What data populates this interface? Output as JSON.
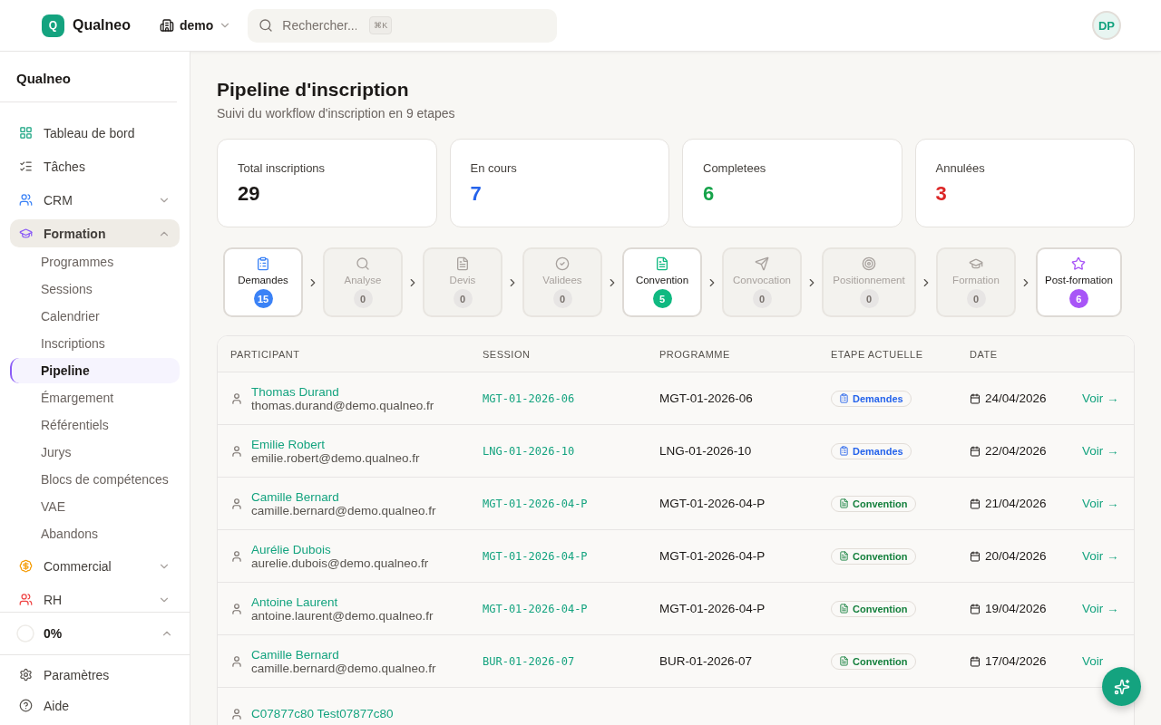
{
  "header": {
    "logo_letter": "Q",
    "brand": "Qualneo",
    "workspace": "demo",
    "search": {
      "placeholder": "Rechercher...",
      "shortcut": "⌘K"
    },
    "avatar": "DP"
  },
  "sidebar": {
    "title": "Qualneo",
    "items": [
      {
        "label": "Tableau de bord",
        "selected": false
      },
      {
        "label": "Tâches",
        "selected": false
      },
      {
        "label": "CRM",
        "selected": false,
        "expanded": false
      },
      {
        "label": "Formation",
        "selected": true,
        "expanded": true,
        "children": [
          {
            "label": "Programmes",
            "selected": false
          },
          {
            "label": "Sessions",
            "selected": false
          },
          {
            "label": "Calendrier",
            "selected": false
          },
          {
            "label": "Inscriptions",
            "selected": false
          },
          {
            "label": "Pipeline",
            "selected": true
          },
          {
            "label": "Émargement",
            "selected": false
          },
          {
            "label": "Référentiels",
            "selected": false
          },
          {
            "label": "Jurys",
            "selected": false
          },
          {
            "label": "Blocs de compétences",
            "selected": false
          },
          {
            "label": "VAE",
            "selected": false
          },
          {
            "label": "Abandons",
            "selected": false
          }
        ]
      },
      {
        "label": "Commercial",
        "selected": false,
        "expanded": false
      },
      {
        "label": "RH",
        "selected": false,
        "expanded": false
      }
    ],
    "progress": {
      "reading": "0%"
    },
    "footer": [
      {
        "label": "Paramètres"
      },
      {
        "label": "Aide"
      }
    ]
  },
  "page": {
    "title": "Pipeline d'inscription",
    "subtitle": "Suivi du workflow d'inscription en 9 etapes"
  },
  "stats": [
    {
      "label": "Total inscriptions",
      "value": "29",
      "color": "#1c1917"
    },
    {
      "label": "En cours",
      "value": "7",
      "color": "#2563eb"
    },
    {
      "label": "Completees",
      "value": "6",
      "color": "#16a34a"
    },
    {
      "label": "Annulées",
      "value": "3",
      "color": "#dc2626"
    }
  ],
  "stages": [
    {
      "label": "Demandes",
      "count": "15",
      "active": true,
      "color": "#3b82f6"
    },
    {
      "label": "Analyse",
      "count": "0",
      "active": false,
      "color": "#e7e5e4"
    },
    {
      "label": "Devis",
      "count": "0",
      "active": false,
      "color": "#e7e5e4"
    },
    {
      "label": "Validees",
      "count": "0",
      "active": false,
      "color": "#e7e5e4"
    },
    {
      "label": "Convention",
      "count": "5",
      "active": true,
      "color": "#10b981"
    },
    {
      "label": "Convocation",
      "count": "0",
      "active": false,
      "color": "#e7e5e4"
    },
    {
      "label": "Positionnement",
      "count": "0",
      "active": false,
      "color": "#e7e5e4"
    },
    {
      "label": "Formation",
      "count": "0",
      "active": false,
      "color": "#e7e5e4"
    },
    {
      "label": "Post-formation",
      "count": "6",
      "active": true,
      "color": "#a855f7"
    }
  ],
  "table": {
    "columns": [
      "PARTICIPANT",
      "SESSION",
      "PROGRAMME",
      "ETAPE ACTUELLE",
      "DATE"
    ],
    "rows": [
      {
        "name": "Thomas Durand",
        "email": "thomas.durand@demo.qualneo.fr",
        "session": "MGT-01-2026-06",
        "programme": "MGT-01-2026-06",
        "stage": {
          "label": "Demandes",
          "kind": "request"
        },
        "date": "24/04/2026",
        "action": "Voir →"
      },
      {
        "name": "Emilie Robert",
        "email": "emilie.robert@demo.qualneo.fr",
        "session": "LNG-01-2026-10",
        "programme": "LNG-01-2026-10",
        "stage": {
          "label": "Demandes",
          "kind": "request"
        },
        "date": "22/04/2026",
        "action": "Voir →"
      },
      {
        "name": "Camille Bernard",
        "email": "camille.bernard@demo.qualneo.fr",
        "session": "MGT-01-2026-04-P",
        "programme": "MGT-01-2026-04-P",
        "stage": {
          "label": "Convention",
          "kind": "agreement"
        },
        "date": "21/04/2026",
        "action": "Voir →"
      },
      {
        "name": "Aurélie Dubois",
        "email": "aurelie.dubois@demo.qualneo.fr",
        "session": "MGT-01-2026-04-P",
        "programme": "MGT-01-2026-04-P",
        "stage": {
          "label": "Convention",
          "kind": "agreement"
        },
        "date": "20/04/2026",
        "action": "Voir →"
      },
      {
        "name": "Antoine Laurent",
        "email": "antoine.laurent@demo.qualneo.fr",
        "session": "MGT-01-2026-04-P",
        "programme": "MGT-01-2026-04-P",
        "stage": {
          "label": "Convention",
          "kind": "agreement"
        },
        "date": "19/04/2026",
        "action": "Voir →"
      },
      {
        "name": "Camille Bernard",
        "email": "camille.bernard@demo.qualneo.fr",
        "session": "BUR-01-2026-07",
        "programme": "BUR-01-2026-07",
        "stage": {
          "label": "Convention",
          "kind": "agreement"
        },
        "date": "17/04/2026",
        "action": "Voir"
      },
      {
        "name": "C07877c80 Test07877c80"
      }
    ]
  }
}
